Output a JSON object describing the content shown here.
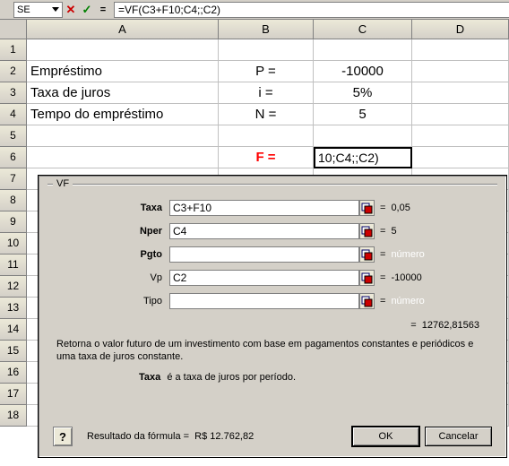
{
  "namebox": "SE",
  "formula": "=VF(C3+F10;C4;;C2)",
  "columns": [
    "A",
    "B",
    "C",
    "D"
  ],
  "rows": {
    "r2": {
      "a": "Empréstimo",
      "b": "P =",
      "c": "-10000"
    },
    "r3": {
      "a": "Taxa de juros",
      "b": "i =",
      "c": "5%"
    },
    "r4": {
      "a": "Tempo do empréstimo",
      "b": "N =",
      "c": "5"
    },
    "r6": {
      "b": "F =",
      "c": "10;C4;;C2)"
    }
  },
  "dialog": {
    "title": "VF",
    "fields": {
      "taxa": {
        "label": "Taxa",
        "value": "C3+F10",
        "result": "0,05"
      },
      "nper": {
        "label": "Nper",
        "value": "C4",
        "result": "5"
      },
      "pgto": {
        "label": "Pgto",
        "value": "",
        "result": "número"
      },
      "vp": {
        "label": "Vp",
        "value": "C2",
        "result": "-10000"
      },
      "tipo": {
        "label": "Tipo",
        "value": "",
        "result": "número"
      }
    },
    "eq": "=",
    "calc_result": "12762,81563",
    "description": "Retorna o valor futuro de um investimento com base em pagamentos constantes e periódicos e uma taxa de juros constante.",
    "arg_name": "Taxa",
    "arg_desc": " é a taxa de juros por período.",
    "formula_result_label": "Resultado da fórmula =",
    "formula_result_value": "R$ 12.762,82",
    "ok": "OK",
    "cancel": "Cancelar",
    "help": "?"
  }
}
